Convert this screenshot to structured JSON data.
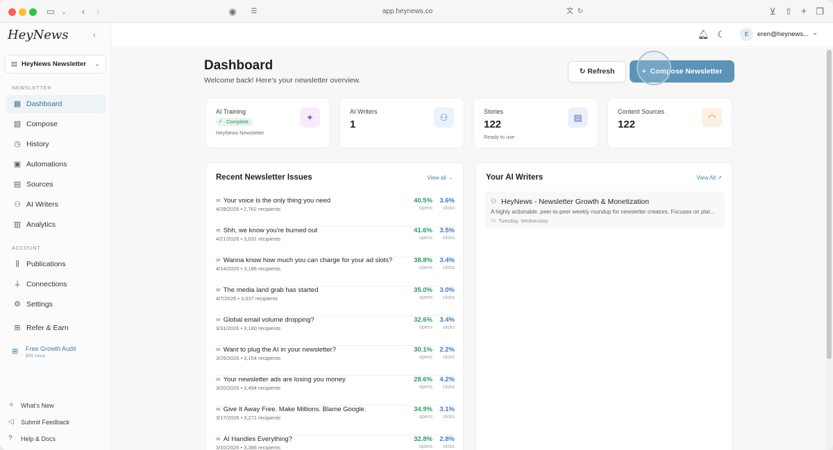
{
  "browser": {
    "url": "app.heynews.co"
  },
  "sidebar": {
    "logo": "HeyNews",
    "publication": "HeyNews Newsletter",
    "section_newsletter": "NEWSLETTER",
    "section_account": "ACCOUNT",
    "newsletter_items": [
      {
        "label": "Dashboard",
        "icon": "grid-icon",
        "active": true
      },
      {
        "label": "Compose",
        "icon": "compose-icon"
      },
      {
        "label": "History",
        "icon": "clock-icon"
      },
      {
        "label": "Automations",
        "icon": "calendar-icon"
      },
      {
        "label": "Sources",
        "icon": "document-icon"
      },
      {
        "label": "AI Writers",
        "icon": "robot-icon"
      },
      {
        "label": "Analytics",
        "icon": "chart-icon"
      }
    ],
    "account_items": [
      {
        "label": "Publications",
        "icon": "library-icon"
      },
      {
        "label": "Connections",
        "icon": "plug-icon"
      },
      {
        "label": "Settings",
        "icon": "gear-icon"
      }
    ],
    "refer": {
      "label": "Refer & Earn",
      "icon": "gift-icon"
    },
    "audit": {
      "title": "Free Growth Audit",
      "subtitle": "$99 value"
    },
    "footer": [
      {
        "label": "What's New",
        "icon": "sparkle-icon"
      },
      {
        "label": "Submit Feedback",
        "icon": "megaphone-icon"
      },
      {
        "label": "Help & Docs",
        "icon": "help-icon"
      }
    ]
  },
  "topbar": {
    "avatar_initial": "E",
    "user": "eren@heynews..."
  },
  "header": {
    "title": "Dashboard",
    "subtitle": "Welcome back! Here's your newsletter overview.",
    "refresh_label": "Refresh",
    "compose_label": "Compose Newsletter"
  },
  "stats": [
    {
      "label": "AI Training",
      "badge": "Complete",
      "note": "HeyNews Newsletter",
      "icon": "sparkle-icon"
    },
    {
      "label": "AI Writers",
      "value": "1",
      "icon": "robot-icon"
    },
    {
      "label": "Stories",
      "value": "122",
      "note": "Ready to use",
      "icon": "document-icon"
    },
    {
      "label": "Content Sources",
      "value": "122",
      "icon": "rss-icon"
    }
  ],
  "issues_panel": {
    "title": "Recent Newsletter Issues",
    "link": "View all →",
    "opens_label": "opens",
    "clicks_label": "clicks",
    "issues": [
      {
        "title": "Your voice is the only thing you need",
        "meta": "4/28/2026 • 2,762 recipients",
        "opens": "40.5%",
        "clicks": "3.6%"
      },
      {
        "title": "Shh, we know you're burned out",
        "meta": "4/21/2026 • 3,031 recipients",
        "opens": "41.6%",
        "clicks": "3.5%"
      },
      {
        "title": "Wanna know how much you can charge for your ad slots?",
        "meta": "4/14/2026 • 3,186 recipients",
        "opens": "38.8%",
        "clicks": "3.4%"
      },
      {
        "title": "The media land grab has started",
        "meta": "4/7/2026 • 3,537 recipients",
        "opens": "35.0%",
        "clicks": "3.0%"
      },
      {
        "title": "Global email volume dropping?",
        "meta": "3/31/2026 • 3,180 recipients",
        "opens": "32.6%",
        "clicks": "3.4%"
      },
      {
        "title": "Want to plug the AI in your newsletter?",
        "meta": "3/25/2026 • 3,154 recipients",
        "opens": "30.1%",
        "clicks": "2.2%"
      },
      {
        "title": "Your newsletter ads are losing you money",
        "meta": "3/20/2026 • 3,494 recipients",
        "opens": "28.6%",
        "clicks": "4.2%"
      },
      {
        "title": "Give It Away Free. Make Millions. Blame Google.",
        "meta": "3/17/2026 • 3,271 recipients",
        "opens": "34.9%",
        "clicks": "3.1%"
      },
      {
        "title": "AI Handles Everything?",
        "meta": "3/10/2026 • 3,386 recipients",
        "opens": "32.8%",
        "clicks": "2.8%"
      }
    ]
  },
  "writers_panel": {
    "title": "Your AI Writers",
    "link": "View All",
    "writer": {
      "name": "HeyNews - Newsletter Growth & Monetization",
      "description": "A highly actionable, peer-to-peer weekly roundup for newsletter creators. Focuses on plat...",
      "schedule": "Tuesday, Wednesday"
    }
  }
}
